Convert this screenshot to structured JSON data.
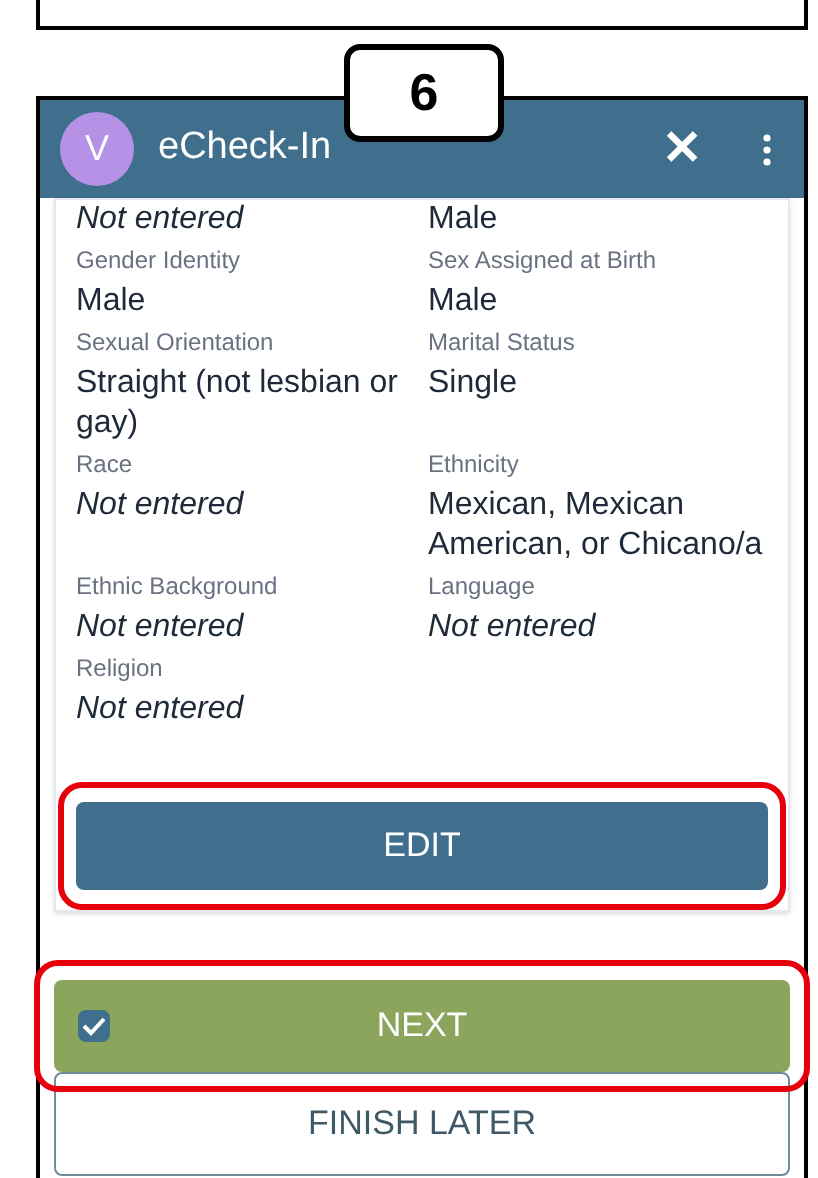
{
  "callout": {
    "number": "6"
  },
  "app_bar": {
    "avatar_letter": "V",
    "title": "eCheck-In",
    "close_icon": "✕"
  },
  "fields": [
    {
      "value": "Not entered",
      "missing": true
    },
    {
      "value": "Male",
      "missing": false
    },
    {
      "label": "Gender Identity",
      "value": "Male",
      "missing": false
    },
    {
      "label": "Sex Assigned at Birth",
      "value": "Male",
      "missing": false
    },
    {
      "label": "Sexual Orientation",
      "value": "Straight (not lesbian or gay)",
      "missing": false
    },
    {
      "label": "Marital Status",
      "value": "Single",
      "missing": false
    },
    {
      "label": "Race",
      "value": "Not entered",
      "missing": true
    },
    {
      "label": "Ethnicity",
      "value": "Mexican, Mexican American, or Chicano/a",
      "missing": false
    },
    {
      "label": "Ethnic Background",
      "value": "Not entered",
      "missing": true
    },
    {
      "label": "Language",
      "value": "Not entered",
      "missing": true
    },
    {
      "label": "Religion",
      "value": "Not entered",
      "missing": true
    }
  ],
  "edit_button": {
    "label": "EDIT",
    "highlighted": true
  },
  "next_button": {
    "label": "NEXT",
    "checked": true,
    "highlighted": true
  },
  "finish_later_button": {
    "label": "FINISH LATER"
  }
}
